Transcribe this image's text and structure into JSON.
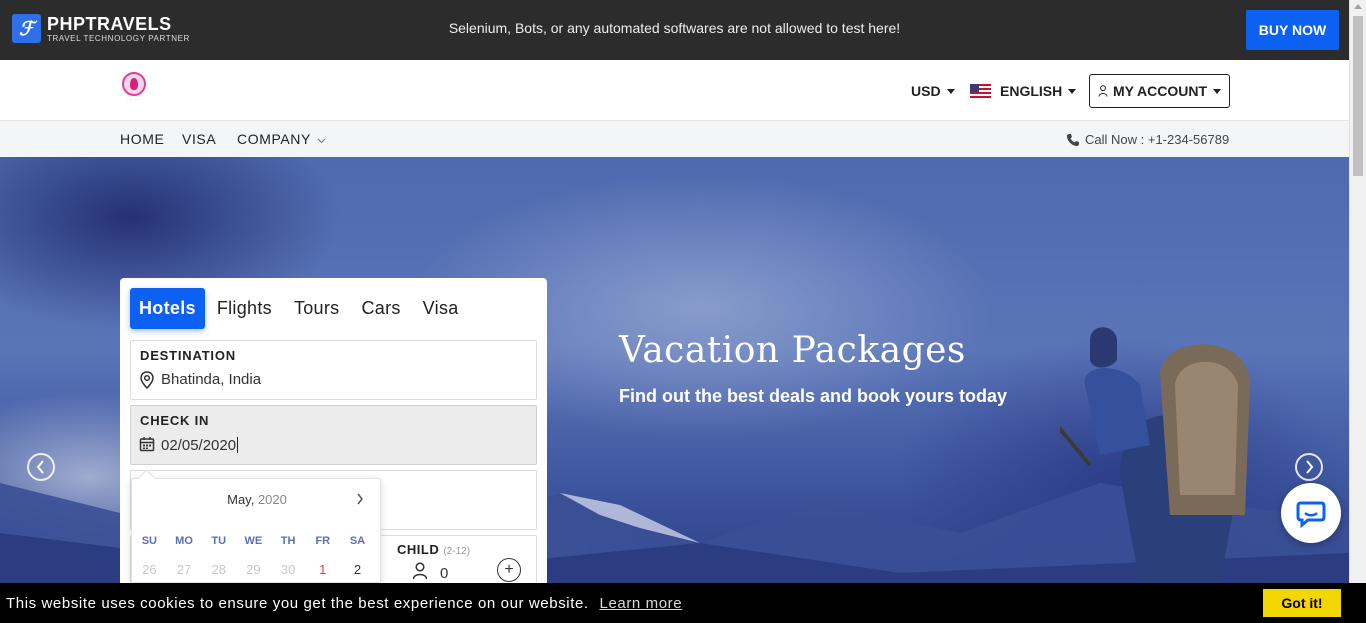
{
  "topbar": {
    "logo_title": "PHPTRAVELS",
    "logo_subtitle": "TRAVEL TECHNOLOGY PARTNER",
    "notice": "Selenium, Bots, or any automated softwares are not allowed to test here!",
    "buy_now": "BUY NOW"
  },
  "header": {
    "currency": "USD",
    "language": "ENGLISH",
    "account": "MY ACCOUNT"
  },
  "nav": {
    "items": [
      "HOME",
      "VISA",
      "COMPANY"
    ],
    "call_now": "Call Now : +1-234-56789"
  },
  "hero": {
    "title": "Vacation Packages",
    "subtitle": "Find out the best deals and book yours today"
  },
  "search": {
    "tabs": [
      "Hotels",
      "Flights",
      "Tours",
      "Cars",
      "Visa"
    ],
    "active_tab": "Hotels",
    "destination_label": "DESTINATION",
    "destination_value": "Bhatinda, India",
    "checkin_label": "CHECK IN",
    "checkin_value": "02/05/2020",
    "child_label": "CHILD",
    "child_range": "(2-12)",
    "child_count": "0"
  },
  "datepicker": {
    "month": "May,",
    "year": "2020",
    "weekdays": [
      "SU",
      "MO",
      "TU",
      "WE",
      "TH",
      "FR",
      "SA"
    ],
    "days": [
      "26",
      "27",
      "28",
      "29",
      "30",
      "1",
      "2"
    ]
  },
  "cookie": {
    "text": "This website uses cookies to ensure you get the best experience on our website.",
    "link": "Learn more",
    "button": "Got it!"
  },
  "colors": {
    "brand_blue": "#0d61f2",
    "topbar_bg": "#2c2c2c",
    "cookie_button": "#f1d600"
  }
}
